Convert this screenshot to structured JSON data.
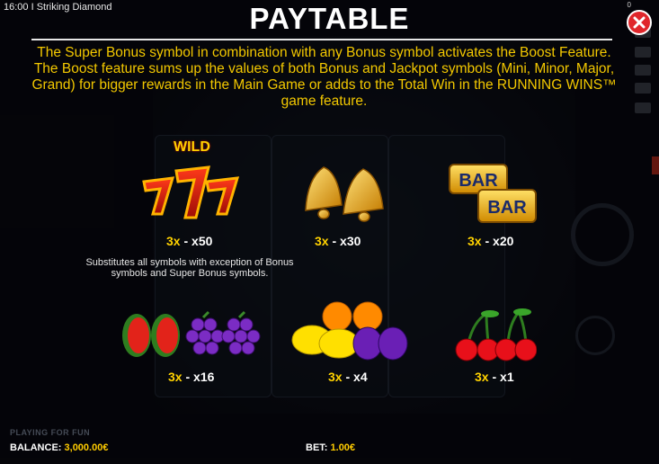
{
  "game": {
    "clock": "16:00",
    "separator": "I",
    "name": "Striking Diamond",
    "counter": "0"
  },
  "paytable": {
    "title": "PAYTABLE",
    "description": "The Super Bonus symbol in combination with any Bonus symbol activates the Boost Feature. The Boost feature sums up the values of both Bonus and Jackpot symbols (Mini, Minor, Major, Grand) for bigger rewards in the Main Game or adds to the Total Win in the RUNNING WINS™ game feature.",
    "wild_label": "WILD",
    "wild_note": "Substitutes all symbols with exception of Bonus symbols and Super Bonus symbols.",
    "entries": [
      {
        "symbol": "seven-icon",
        "count": "3x",
        "sep": " - ",
        "payout": "x50"
      },
      {
        "symbol": "bell-icon",
        "count": "3x",
        "sep": " - ",
        "payout": "x30"
      },
      {
        "symbol": "bar-icon",
        "count": "3x",
        "sep": " - ",
        "payout": "x20"
      },
      {
        "symbol": "watermelon-grapes-icon",
        "count": "3x",
        "sep": " - ",
        "payout": "x16"
      },
      {
        "symbol": "lemon-orange-plum-icon",
        "count": "3x",
        "sep": " - ",
        "payout": "x4"
      },
      {
        "symbol": "cherry-icon",
        "count": "3x",
        "sep": " - ",
        "payout": "x1"
      }
    ],
    "bar_text": "BAR"
  },
  "footer": {
    "mode": "PLAYING FOR FUN",
    "balance_label": "BALANCE:",
    "balance_value": "3,000.00€",
    "bet_label": "BET:",
    "bet_value": "1.00€"
  },
  "colors": {
    "accent": "#f3c800",
    "close": "#e0262b"
  }
}
